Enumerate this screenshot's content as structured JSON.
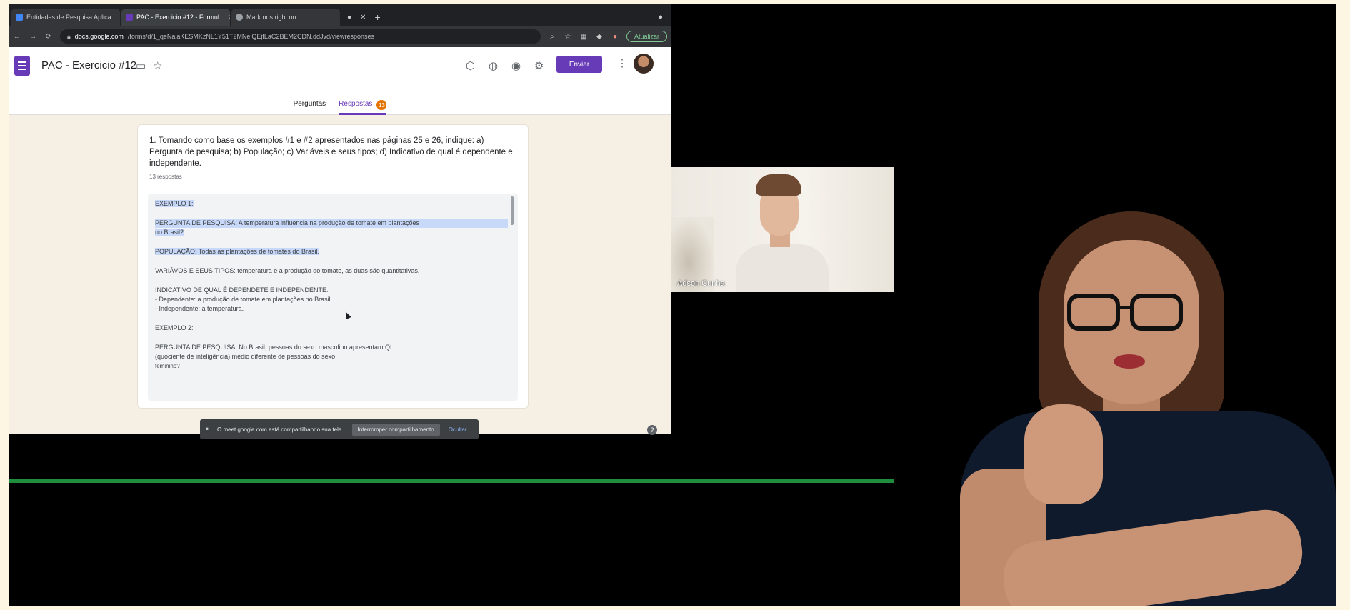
{
  "browser": {
    "tabs": [
      {
        "label": "Entidades de Pesquisa Aplica...",
        "active": false
      },
      {
        "label": "PAC - Exercicio #12 - Formul...",
        "active": true
      },
      {
        "label": "Mark nos right on",
        "active": false
      }
    ],
    "url_host": "docs.google.com",
    "url_path": "/forms/d/1_qeNaiaKESMKzNL1Y51T2MNelQEjfLaC2BEM2CDN.ddJvd/viewresponses",
    "update_label": "Atualizar"
  },
  "form": {
    "title": "PAC - Exercicio #12",
    "send_label": "Enviar",
    "tabs": {
      "questions": "Perguntas",
      "responses": "Respostas",
      "responses_count": "13"
    },
    "question": "1. Tomando como base os exemplos #1 e #2 apresentados nas páginas 25 e 26, indique: a) Pergunta de pesquisa; b) População; c) Variáveis e seus tipos; d) Indicativo de qual é dependente e independente.",
    "response_count": "13 respostas",
    "response": {
      "ex1": "EXEMPLO 1:",
      "q1a": "PERGUNTA DE PESQUISA: A temperatura influencia na produção de tomate em plantações",
      "q1b": "no Brasil?",
      "pop1": "POPULAÇÃO: Todas as plantações de tomates do Brasil.",
      "var1": "VARIÁVOS E SEUS TIPOS: temperatura e a produção do tomate, as duas são quantitativas.",
      "ind1": "INDICATIVO DE QUAL É DEPENDETE E INDEPENDENTE:",
      "dep1": "- Dependente: a produção de tomate em plantações no Brasil.",
      "indep1": "- Independente: a temperatura.",
      "ex2": "EXEMPLO 2:",
      "q2a": "PERGUNTA DE PESQUISA: No Brasil, pessoas do sexo masculino apresentam QI",
      "q2b": "(quociente de inteligência) médio diferente de pessoas do sexo",
      "q2c": "feminino?"
    }
  },
  "share_bar": {
    "message": "O meet.google.com está compartilhando sua tela.",
    "stop_label": "Interromper compartilhamento",
    "hide_label": "Ocultar"
  },
  "participant": {
    "name": "Adson Cunha"
  },
  "colors": {
    "forms_purple": "#673ab7",
    "meet_green": "#1e8e3e",
    "frame": "#fdf6e3"
  }
}
